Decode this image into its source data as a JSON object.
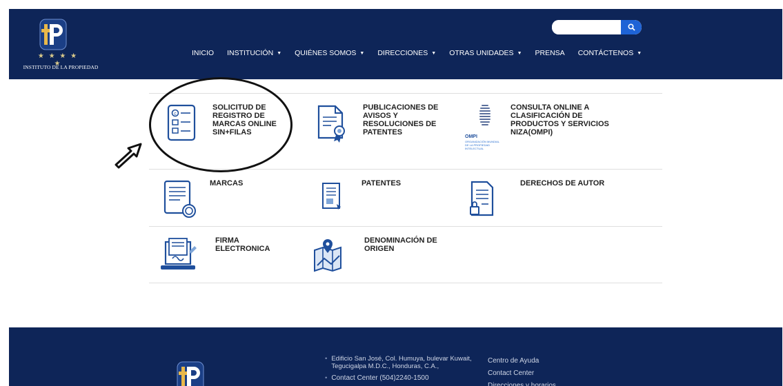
{
  "header": {
    "logo_text": "INSTITUTO DE LA PROPIEDAD",
    "logo_stars": "★ ★ ★ ★ ★",
    "search_placeholder": "",
    "nav": [
      {
        "label": "INICIO",
        "dropdown": false
      },
      {
        "label": "INSTITUCIÓN",
        "dropdown": true
      },
      {
        "label": "QUIÉNES SOMOS",
        "dropdown": true
      },
      {
        "label": "DIRECCIONES",
        "dropdown": true
      },
      {
        "label": "OTRAS UNIDADES",
        "dropdown": true
      },
      {
        "label": "PRENSA",
        "dropdown": false
      },
      {
        "label": "CONTÁCTENOS",
        "dropdown": true
      }
    ]
  },
  "cards": [
    {
      "label": "SOLICITUD DE REGISTRO DE MARCAS ONLINE SIN+FILAS",
      "icon": "registration-form-icon"
    },
    {
      "label": "PUBLICACIONES DE AVISOS Y RESOLUCIONES DE PATENTES",
      "icon": "certificate-document-icon"
    },
    {
      "label": "CONSULTA ONLINE A CLASIFICACIÓN DE PRODUCTOS Y SERVICIOS NIZA(OMPI)",
      "icon": "ompi-logo-icon"
    },
    {
      "label": "MARCAS",
      "icon": "trademark-document-icon"
    },
    {
      "label": "PATENTES",
      "icon": "patent-document-icon"
    },
    {
      "label": "DERECHOS DE AUTOR",
      "icon": "copyright-lock-document-icon"
    },
    {
      "label": "FIRMA ELECTRONICA",
      "icon": "laptop-signature-icon"
    },
    {
      "label": "DENOMINACIÓN DE ORIGEN",
      "icon": "map-location-icon"
    }
  ],
  "ompi_text": {
    "name": "OMPI",
    "line1": "ORGANIZACIÓN MUNDIAL",
    "line2": "DE LA PROPIEDAD",
    "line3": "INTELECTUAL"
  },
  "footer": {
    "address": [
      "Edificio San José, Col. Humuya, bulevar Kuwait, Tegucigalpa M.D.C., Honduras, C.A.,",
      "Contact Center (504)2240-1500"
    ],
    "links": [
      "Centro de Ayuda",
      "Contact Center",
      "Direcciones y horarios"
    ]
  },
  "colors": {
    "navy": "#0e2558",
    "accent_blue": "#1e63d6",
    "icon_blue": "#1f4f9c",
    "icon_light": "#7fa6d8"
  }
}
